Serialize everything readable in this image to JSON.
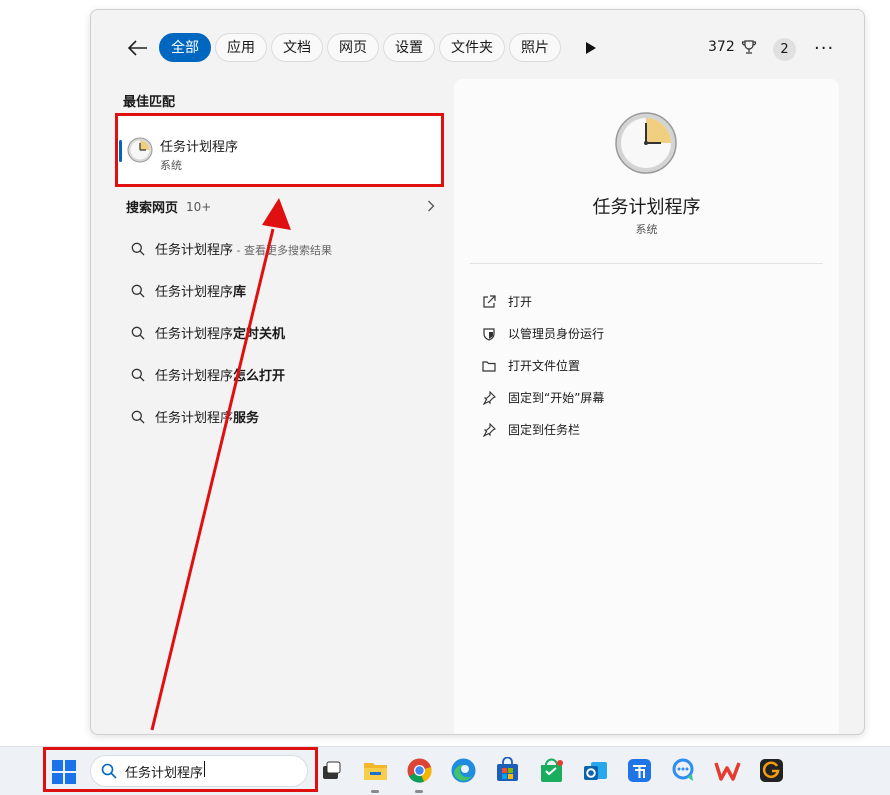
{
  "header": {
    "tabs": [
      {
        "label": "全部",
        "active": true
      },
      {
        "label": "应用"
      },
      {
        "label": "文档"
      },
      {
        "label": "网页"
      },
      {
        "label": "设置"
      },
      {
        "label": "文件夹"
      },
      {
        "label": "照片"
      }
    ],
    "points": "372",
    "notifications": "2",
    "more": "···"
  },
  "best_match": {
    "title": "最佳匹配",
    "app_name": "任务计划程序",
    "app_type": "系统"
  },
  "web": {
    "title": "搜索网页",
    "count": "10+",
    "suggestions": [
      {
        "base": "任务计划程序",
        "bold": "",
        "hint": " - 查看更多搜索结果"
      },
      {
        "base": "任务计划程序",
        "bold": "库",
        "hint": ""
      },
      {
        "base": "任务计划程序",
        "bold": "定时关机",
        "hint": ""
      },
      {
        "base": "任务计划程序",
        "bold": "怎么打开",
        "hint": ""
      },
      {
        "base": "任务计划程序",
        "bold": "服务",
        "hint": ""
      }
    ]
  },
  "detail": {
    "name": "任务计划程序",
    "type": "系统",
    "actions": [
      {
        "label": "打开",
        "icon": "open-external-icon"
      },
      {
        "label": "以管理员身份运行",
        "icon": "shield-icon"
      },
      {
        "label": "打开文件位置",
        "icon": "folder-icon"
      },
      {
        "label": "固定到“开始”屏幕",
        "icon": "pin-icon"
      },
      {
        "label": "固定到任务栏",
        "icon": "pin-icon"
      }
    ]
  },
  "taskbar": {
    "search_text": "任务计划程序",
    "apps": [
      {
        "name": "task-view",
        "color": "#3a3a3a"
      },
      {
        "name": "file-explorer",
        "color": "#f3b72b"
      },
      {
        "name": "chrome",
        "color": "#db4437"
      },
      {
        "name": "edge",
        "color": "#1f8ce0"
      },
      {
        "name": "microsoft-store",
        "color": "#1d5fb8"
      },
      {
        "name": "wechat-store",
        "color": "#1aad5e"
      },
      {
        "name": "outlook",
        "color": "#0a64ad"
      },
      {
        "name": "feishu",
        "color": "#1f74e8"
      },
      {
        "name": "chat",
        "color": "#2f8cf0"
      },
      {
        "name": "wps",
        "color": "#e53c2f"
      },
      {
        "name": "g-app",
        "color": "#222222"
      }
    ]
  },
  "colors": {
    "accent": "#0067c0",
    "highlight": "#e01010"
  }
}
